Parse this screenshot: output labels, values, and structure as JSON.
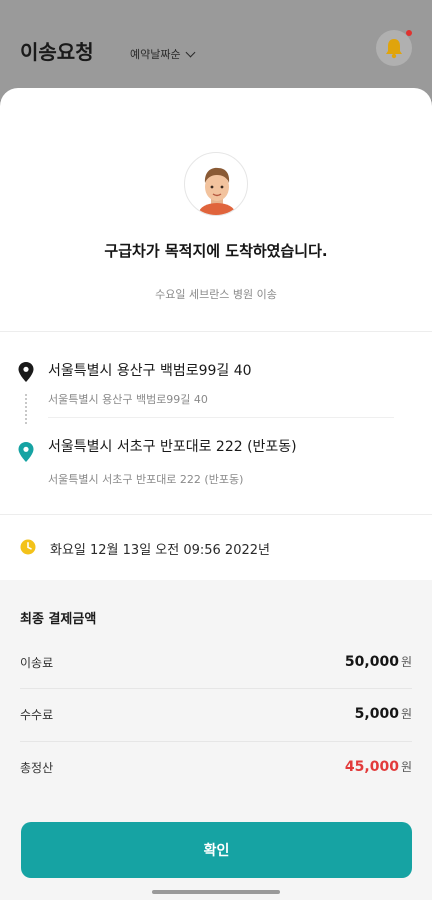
{
  "header": {
    "title": "이송요청",
    "sort_label": "예약날짜순",
    "icons": {
      "sort": "chevron-down-icon",
      "notifications": "bell-icon"
    }
  },
  "arrival": {
    "headline": "구급차가 목적지에 도착하였습니다.",
    "subtitle": "수요일 세브란스 병원 이송"
  },
  "route": {
    "origin": {
      "address": "서울특별시 용산구 백범로99길 40",
      "detail": "서울특별시 용산구 백범로99길 40",
      "icon": "origin-pin-icon"
    },
    "destination": {
      "address": "서울특별시 서초구 반포대로 222 (반포동)",
      "detail": "서울특별시 서초구 반포대로 222 (반포동)",
      "icon": "destination-pin-icon"
    }
  },
  "schedule": {
    "datetime": "화요일 12월 13일 오전 09:56 2022년",
    "icon": "clock-icon"
  },
  "payment": {
    "title": "최종 결제금액",
    "currency": "원",
    "rows": [
      {
        "label": "이송료",
        "amount": "50,000"
      },
      {
        "label": "수수료",
        "amount": "5,000"
      },
      {
        "label": "총정산",
        "amount": "45,000"
      }
    ]
  },
  "confirm_label": "확인",
  "colors": {
    "accent": "#16a3a3",
    "total": "#e23a3a",
    "clock": "#f3c21a",
    "notification_dot": "#e0322f"
  }
}
